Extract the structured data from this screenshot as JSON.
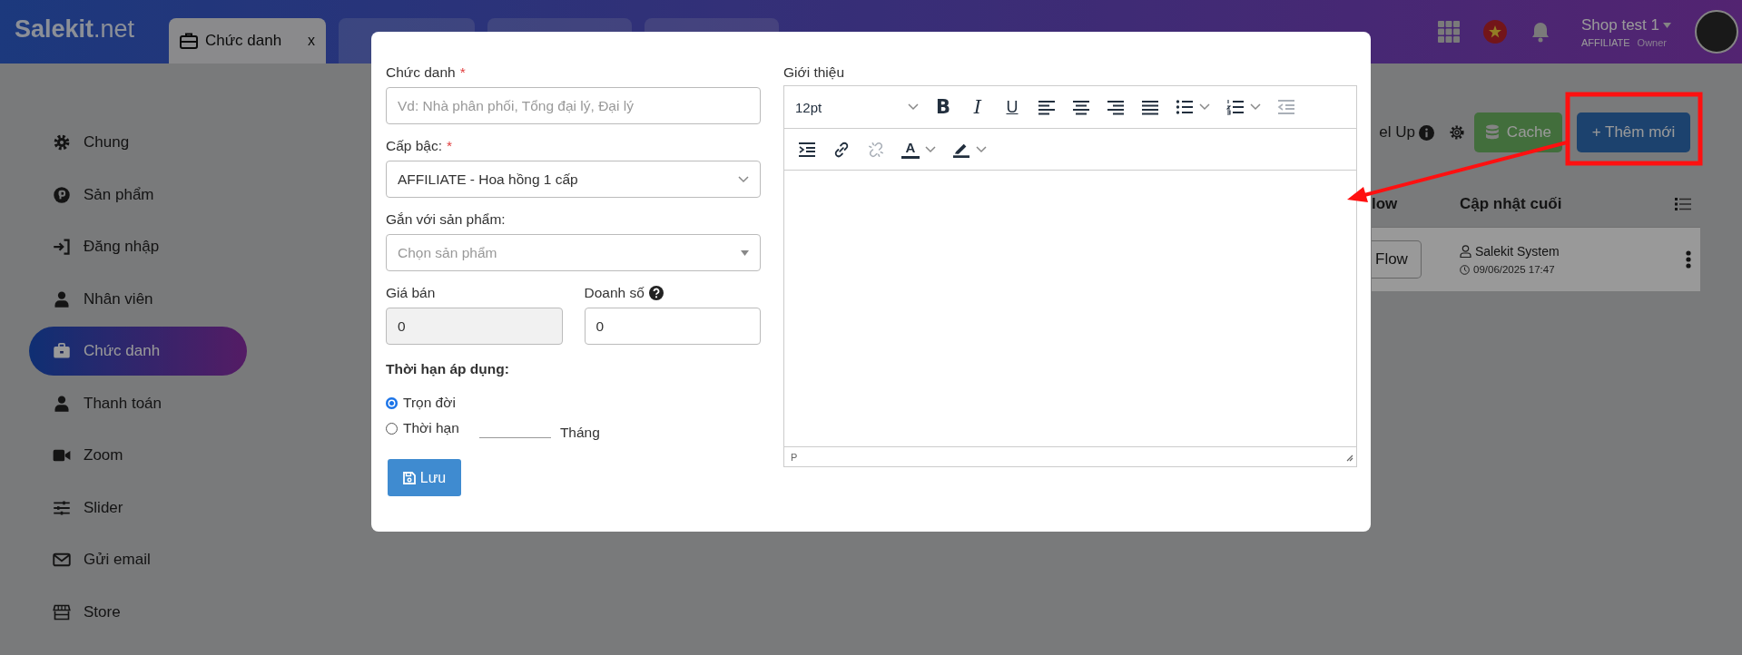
{
  "topbar": {
    "logo": "**Salekit**.net",
    "tabs": [
      {
        "label": "Chức danh",
        "close": "x",
        "selected": true
      },
      {
        "selected": false
      },
      {
        "selected": false
      },
      {
        "selected": false
      }
    ],
    "account": {
      "name": "Shop test 1",
      "role": "AFFILIATE",
      "position": "Owner"
    }
  },
  "sidebar": {
    "items": [
      {
        "label": "Chung",
        "selected": false
      },
      {
        "label": "Sản phẩm",
        "selected": false
      },
      {
        "label": "Đăng nhập",
        "selected": false
      },
      {
        "label": "Nhân viên",
        "selected": false
      },
      {
        "label": "Chức danh",
        "selected": true
      },
      {
        "label": "Thanh toán",
        "selected": false
      },
      {
        "label": "Zoom",
        "selected": false
      },
      {
        "label": "Slider",
        "selected": false
      },
      {
        "label": "Gửi email",
        "selected": false
      },
      {
        "label": "Store",
        "selected": false
      }
    ]
  },
  "page": {
    "toolbar": {
      "level_up": "el Up",
      "cache_button": "Cache",
      "add_button": "+ Thêm mới"
    },
    "table": {
      "columns": [
        "low",
        "Cập nhật cuối"
      ],
      "rows": [
        {
          "action": "Flow",
          "updated_by": "Salekit System",
          "updated_at": "09/06/2025 17:47"
        }
      ]
    }
  },
  "modal": {
    "title_field": {
      "label": "Chức danh",
      "mark": "*",
      "placeholder": "Vd: Nhà phân phối, Tổng đại lý, Đại lý"
    },
    "level_field": {
      "label": "Cấp bậc:",
      "mark": "*",
      "value": "AFFILIATE - Hoa hồng 1 cấp"
    },
    "product_field": {
      "label": "Gắn với sản phẩm:",
      "placeholder": "Chọn sản phẩm"
    },
    "price_field": {
      "label": "Giá bán",
      "value": "0",
      "disabled": true
    },
    "sales_field": {
      "label": "Doanh số",
      "value": "0",
      "disabled": false
    },
    "duration": {
      "label": "Thời hạn áp dụng:",
      "options": [
        {
          "label": "Trọn đời",
          "selected": true
        },
        {
          "label": "Thời hạn",
          "selected": false,
          "unit": "Tháng"
        }
      ]
    },
    "save_button": "Lưu",
    "editor": {
      "label": "Giới thiệu",
      "font_size": "12pt",
      "status_path": "P",
      "toolbar_rows": [
        [
          {
            "kind": "bold",
            "symbol": "B",
            "disabled": false,
            "menu": false
          },
          {
            "kind": "italic",
            "symbol": "I",
            "disabled": false,
            "menu": false
          },
          {
            "kind": "underline",
            "symbol": "U",
            "disabled": false,
            "menu": false
          },
          {
            "kind": "align-left",
            "disabled": false,
            "menu": false
          },
          {
            "kind": "align-center",
            "disabled": false,
            "menu": false
          },
          {
            "kind": "align-right",
            "disabled": false,
            "menu": false
          },
          {
            "kind": "justify",
            "disabled": false,
            "menu": false
          },
          {
            "kind": "bullet-list",
            "disabled": false,
            "menu": true
          },
          {
            "kind": "number-list",
            "disabled": false,
            "menu": true
          },
          {
            "kind": "outdent",
            "disabled": true,
            "menu": false
          }
        ],
        [
          {
            "kind": "indent",
            "disabled": false,
            "menu": false
          },
          {
            "kind": "link",
            "disabled": false,
            "menu": false
          },
          {
            "kind": "unlink",
            "disabled": true,
            "menu": false
          },
          {
            "kind": "text-color",
            "symbol": "A",
            "disabled": false,
            "menu": true
          },
          {
            "kind": "highlight",
            "disabled": false,
            "menu": true
          }
        ]
      ]
    }
  }
}
